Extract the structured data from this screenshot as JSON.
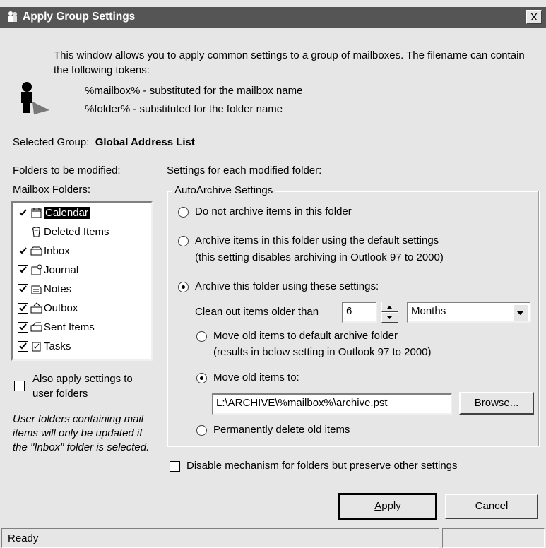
{
  "window": {
    "title": "Apply Group Settings",
    "close_glyph": "X"
  },
  "intro": {
    "text": "This window allows you to apply common settings to a group of mailboxes. The filename can contain the following tokens:",
    "tokens": [
      "%mailbox% - substituted for the mailbox name",
      "%folder% - substituted for the folder name"
    ]
  },
  "group": {
    "label": "Selected Group:",
    "value": "Global Address List"
  },
  "folders": {
    "heading": "Folders to be modified:",
    "sub_heading": "Mailbox Folders:",
    "items": [
      {
        "label": "Calendar",
        "checked": true,
        "selected": true
      },
      {
        "label": "Deleted Items",
        "checked": false
      },
      {
        "label": "Inbox",
        "checked": true
      },
      {
        "label": "Journal",
        "checked": true
      },
      {
        "label": "Notes",
        "checked": true
      },
      {
        "label": "Outbox",
        "checked": true
      },
      {
        "label": "Sent Items",
        "checked": true
      },
      {
        "label": "Tasks",
        "checked": true
      }
    ],
    "also_apply_label_1": "Also apply settings to",
    "also_apply_label_2": "user folders",
    "note": "User folders containing mail items will only be updated if the \"Inbox\" folder is selected."
  },
  "settings": {
    "heading": "Settings for each modified folder:",
    "group_title": "AutoArchive Settings",
    "opt_no_archive": "Do not archive items in this folder",
    "opt_default_1": "Archive items in this folder using the default settings",
    "opt_default_2": "(this setting disables archiving in Outlook 97 to 2000)",
    "opt_custom": "Archive this folder using these settings:",
    "clean_label": "Clean out items older than",
    "clean_value": "6",
    "period": "Months",
    "move_default_1": "Move old items to default archive folder",
    "move_default_2": "(results in below setting in Outlook 97 to 2000)",
    "move_to": "Move old items to:",
    "path": "L:\\ARCHIVE\\%mailbox%\\archive.pst",
    "browse": "Browse...",
    "delete": "Permanently delete old items",
    "disable": "Disable mechanism for folders but preserve other settings"
  },
  "buttons": {
    "apply": "Apply",
    "cancel": "Cancel"
  },
  "status": {
    "text": "Ready"
  }
}
